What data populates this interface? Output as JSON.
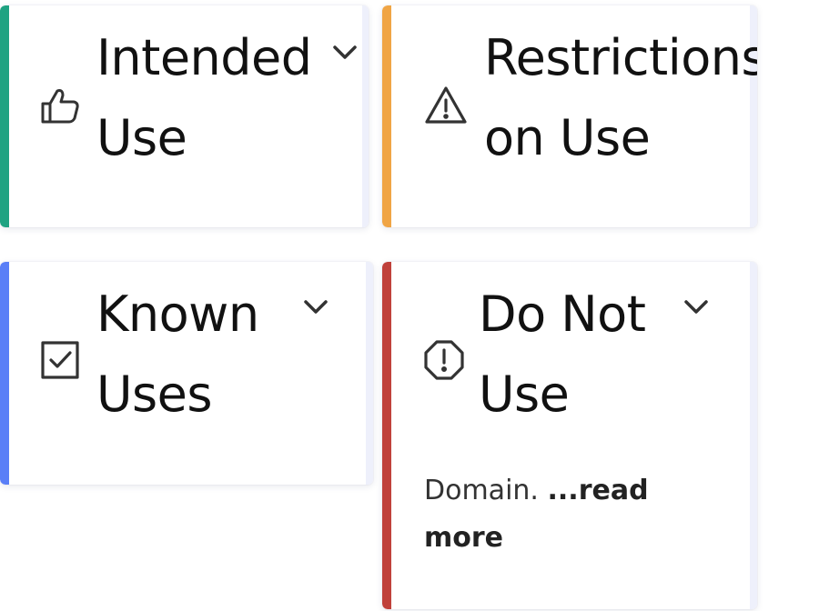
{
  "cards": {
    "intended_use": {
      "title_line1": "Intended",
      "title_line2": "Use",
      "icon": "thumbs-up-icon",
      "accent_color": "#1fa382"
    },
    "restrictions_on_use": {
      "title_line1": "Restrictions",
      "title_line2": "on Use",
      "icon": "warning-triangle-icon",
      "accent_color": "#f0a545"
    },
    "known_uses": {
      "title_line1": "Known",
      "title_line2": "Uses",
      "icon": "checkbox-checked-icon",
      "accent_color": "#5a7ff7"
    },
    "do_not_use": {
      "title_line1": "Do Not",
      "title_line2": "Use",
      "icon": "alert-octagon-icon",
      "accent_color": "#c0413b",
      "description_text": "Domain.",
      "read_more_label": "...read more"
    }
  }
}
